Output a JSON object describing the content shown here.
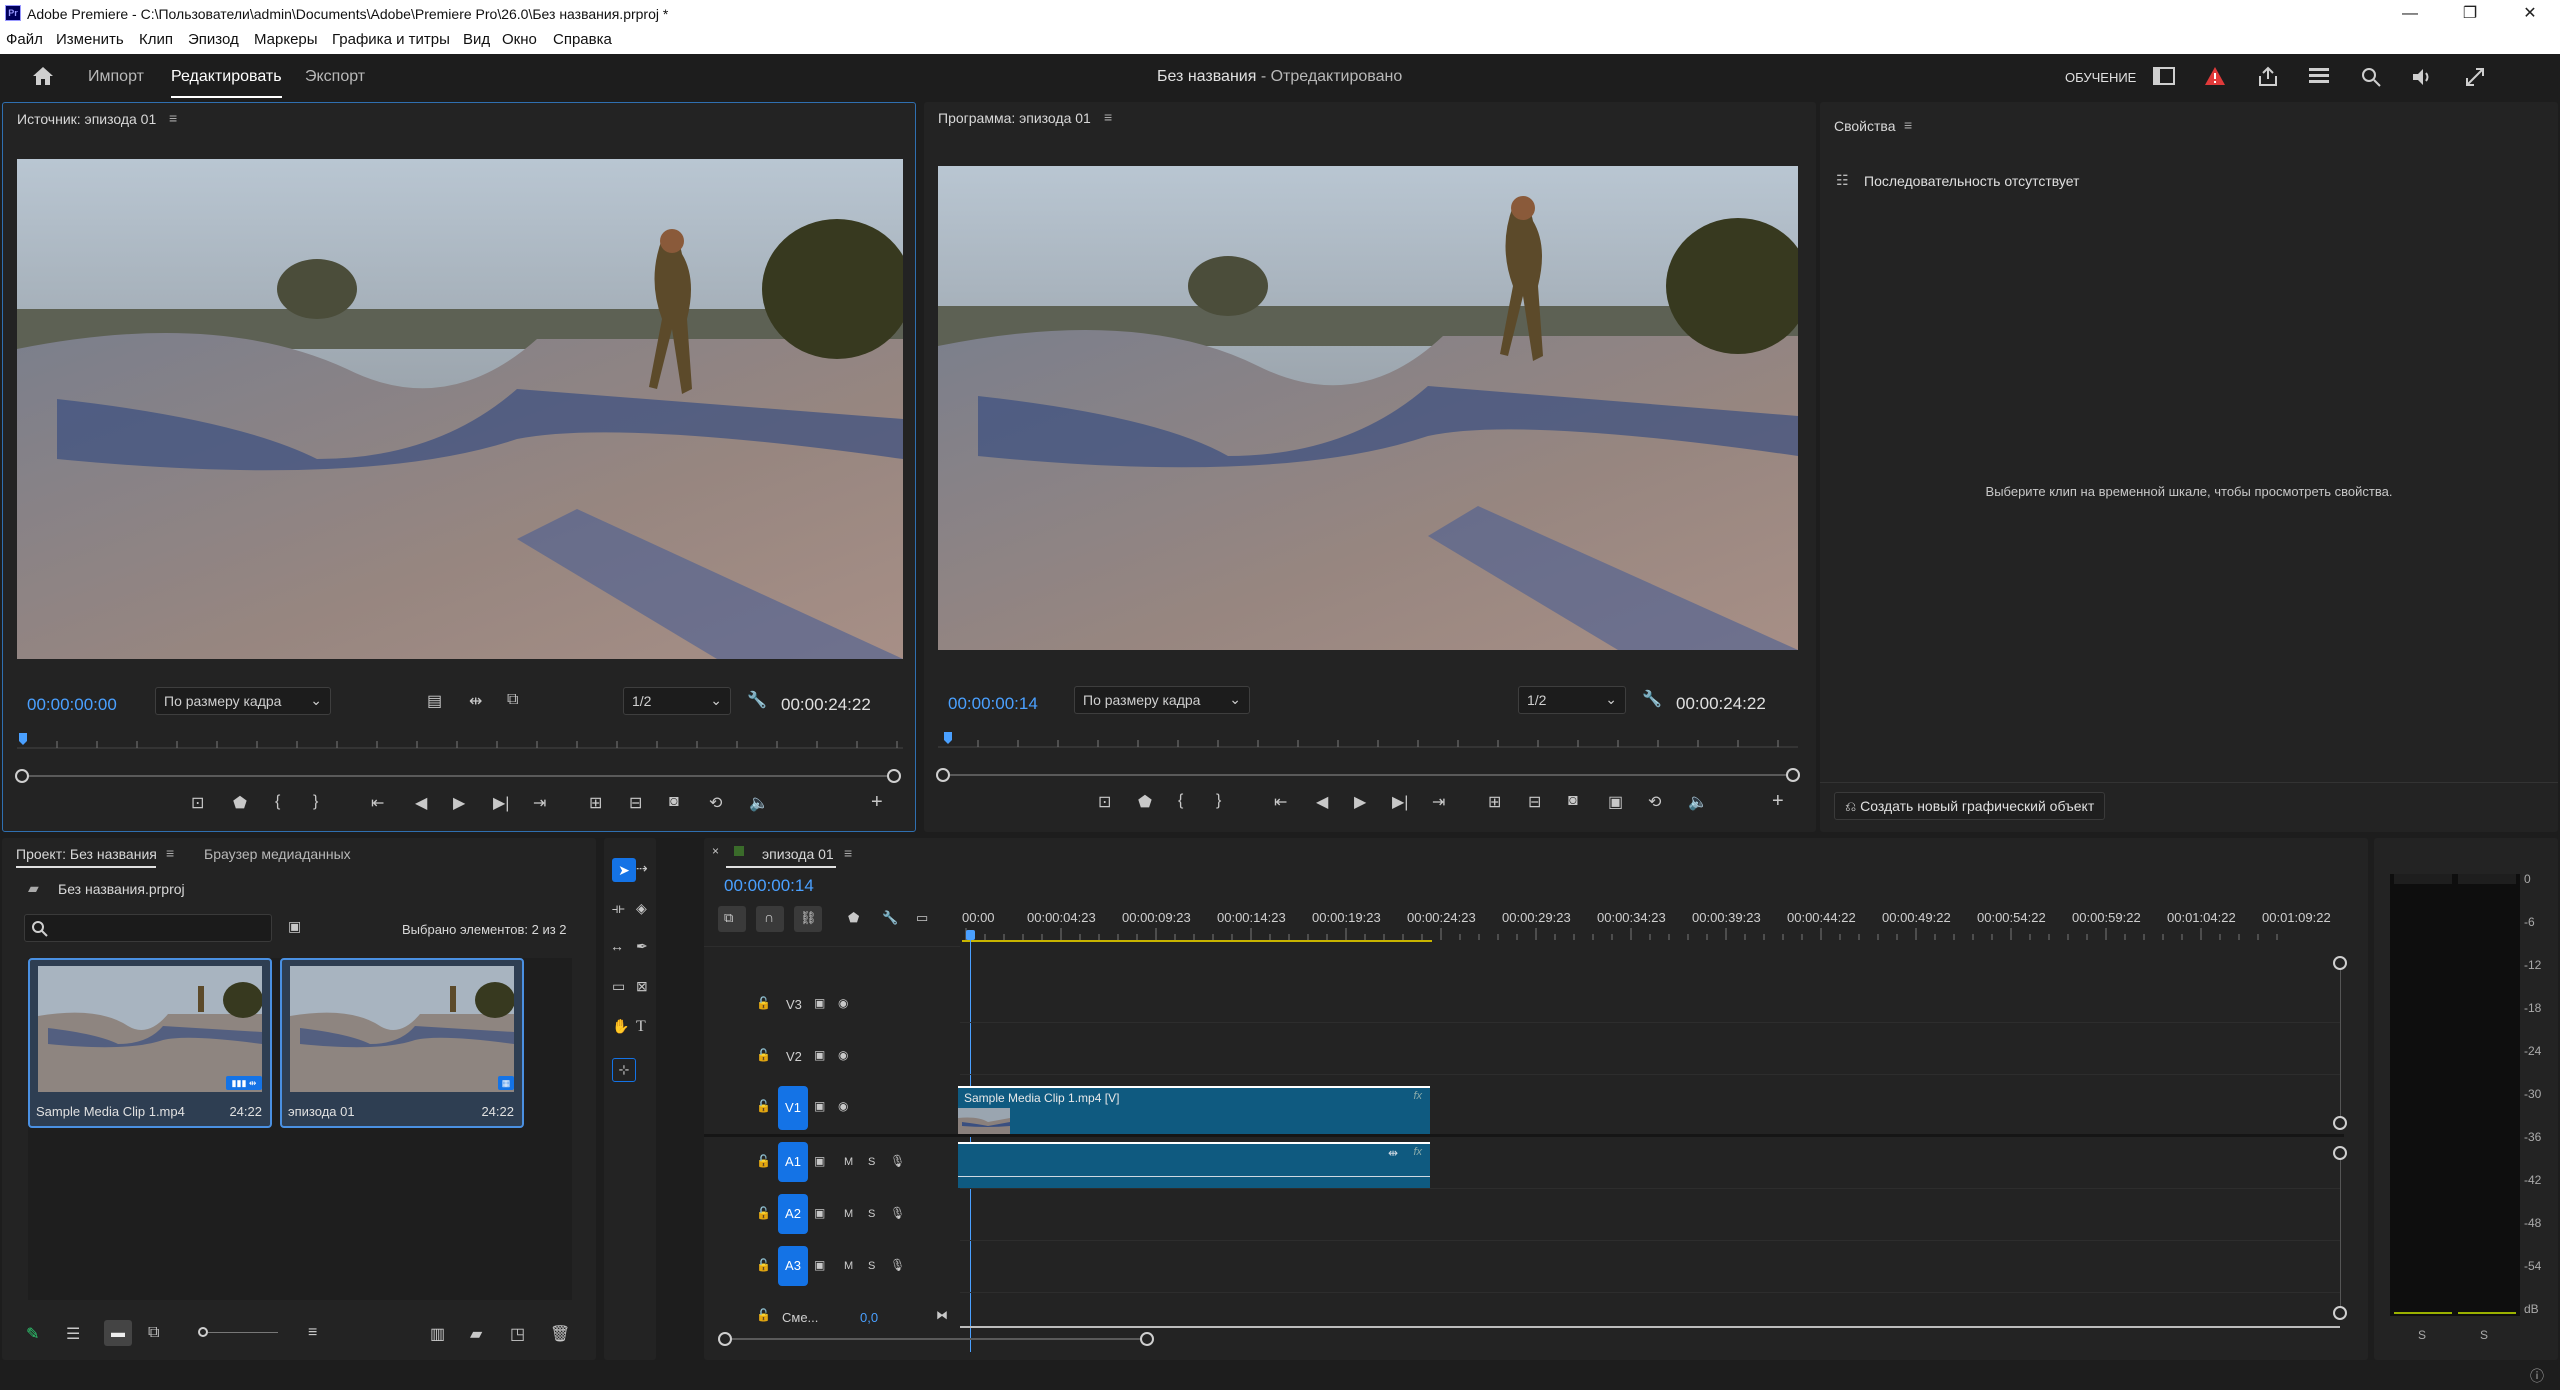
{
  "window": {
    "title": "Adobe Premiere - C:\\Пользователи\\admin\\Documents\\Adobe\\Premiere Pro\\26.0\\Без названия.prproj *",
    "logo": "Pr"
  },
  "menu": [
    "Файл",
    "Изменить",
    "Клип",
    "Эпизод",
    "Маркеры",
    "Графика и титры",
    "Вид",
    "Окно",
    "Справка"
  ],
  "topbar": {
    "tabs": [
      "Импорт",
      "Редактировать",
      "Экспорт"
    ],
    "active_tab": "Редактировать",
    "project_title": "Без названия",
    "project_status": " - Отредактировано",
    "learn_label": "ОБУЧЕНИЕ"
  },
  "source": {
    "title": "Источник: эпизода 01",
    "timecode_in": "00:00:00:00",
    "fit": "По размеру кадра",
    "resolution": "1/2",
    "duration": "00:00:24:22"
  },
  "program": {
    "title": "Программа: эпизода 01",
    "timecode_in": "00:00:00:14",
    "fit": "По размеру кадра",
    "resolution": "1/2",
    "duration": "00:00:24:22"
  },
  "properties": {
    "title": "Свойства",
    "no_sequence": "Последовательность отсутствует",
    "hint": "Выберите клип на временной шкале, чтобы просмотреть свойства.",
    "create_graphic": "Создать новый графический объект"
  },
  "project": {
    "tab_project": "Проект: Без названия",
    "tab_browser": "Браузер медиаданных",
    "file": "Без названия.prproj",
    "search_placeholder": "",
    "selected": "Выбрано элементов: 2 из 2",
    "items": [
      {
        "name": "Sample Media Clip 1.mp4",
        "duration": "24:22"
      },
      {
        "name": "эпизода 01",
        "duration": "24:22"
      }
    ]
  },
  "timeline": {
    "tab": "эпизода 01",
    "timecode": "00:00:00:14",
    "ruler": [
      "00:00",
      "00:00:04:23",
      "00:00:09:23",
      "00:00:14:23",
      "00:00:19:23",
      "00:00:24:23",
      "00:00:29:23",
      "00:00:34:23",
      "00:00:39:23",
      "00:00:44:22",
      "00:00:49:22",
      "00:00:54:22",
      "00:00:59:22",
      "00:01:04:22",
      "00:01:09:22"
    ],
    "video_tracks": [
      "V3",
      "V2",
      "V1"
    ],
    "audio_tracks": [
      "A1",
      "A2",
      "A3"
    ],
    "mix_label": "Сме...",
    "mix_value": "0,0",
    "clip_label": "Sample Media Clip 1.mp4 [V]",
    "track_m": "M",
    "track_s": "S"
  },
  "meter": {
    "scale": [
      "0",
      "-6",
      "-12",
      "-18",
      "-24",
      "-30",
      "-36",
      "-42",
      "-48",
      "-54",
      "dB"
    ],
    "solo": [
      "S",
      "S"
    ]
  },
  "colors": {
    "accent": "#1473e6",
    "timecode": "#4aa0ff",
    "clip": "#0f5a80",
    "error": "#e03a3a"
  }
}
